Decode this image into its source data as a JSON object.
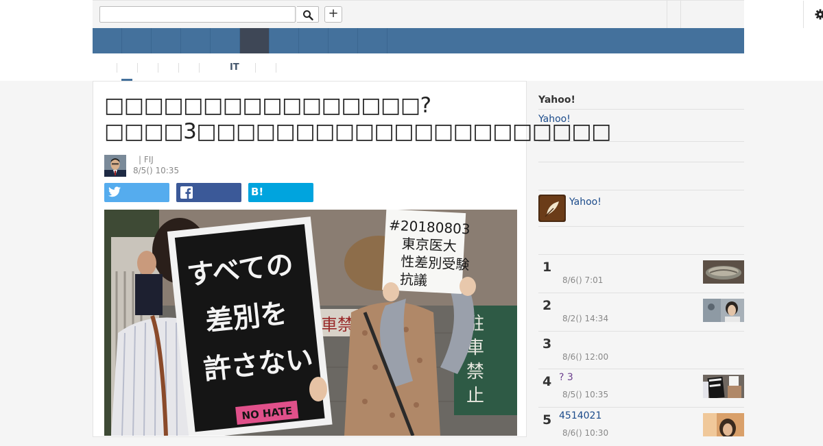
{
  "toolbar": {
    "search_placeholder": "",
    "plus_label": "+"
  },
  "subnav": {
    "items": [
      "",
      "",
      "",
      "",
      "",
      "IT",
      "",
      ""
    ]
  },
  "article": {
    "headline": "□□□□□□□□□□□□□□□□? □□□□3□□□□□□□□□□□□□□□□□□□□□",
    "author_name": "| FIJ",
    "pubdate": "8/5() 10:35",
    "share_hatena_label": "B!",
    "placard_left": [
      "すべての",
      "差別を",
      "許さない"
    ],
    "placard_left_badge": "NO HATE",
    "placard_right": [
      "#20180803",
      "東京医大",
      "性差別受験",
      "抗議"
    ],
    "wall_sign_left": "駐車禁",
    "wall_sign_right": [
      "駐",
      "車",
      "禁",
      "止"
    ]
  },
  "sidebar": {
    "title": "Yahoo!",
    "link": "Yahoo!",
    "feature_link": "Yahoo!",
    "ranking": [
      {
        "num": "1",
        "title": "",
        "time": "8/6() 7:01",
        "visited": false
      },
      {
        "num": "2",
        "title": "",
        "time": "8/2() 14:34",
        "visited": false
      },
      {
        "num": "3",
        "title": "",
        "time": "8/6() 12:00",
        "visited": false
      },
      {
        "num": "4",
        "title": "? 3",
        "time": "8/5() 10:35",
        "visited": true
      },
      {
        "num": "5",
        "title": "4514021",
        "time": "8/6() 10:30",
        "visited": false
      }
    ]
  },
  "colors": {
    "nav_blue": "#44719c",
    "nav_active": "#3e4756",
    "twitter": "#55acee",
    "facebook": "#3b5998",
    "hatena": "#00a4de",
    "link": "#1a4a8a"
  }
}
